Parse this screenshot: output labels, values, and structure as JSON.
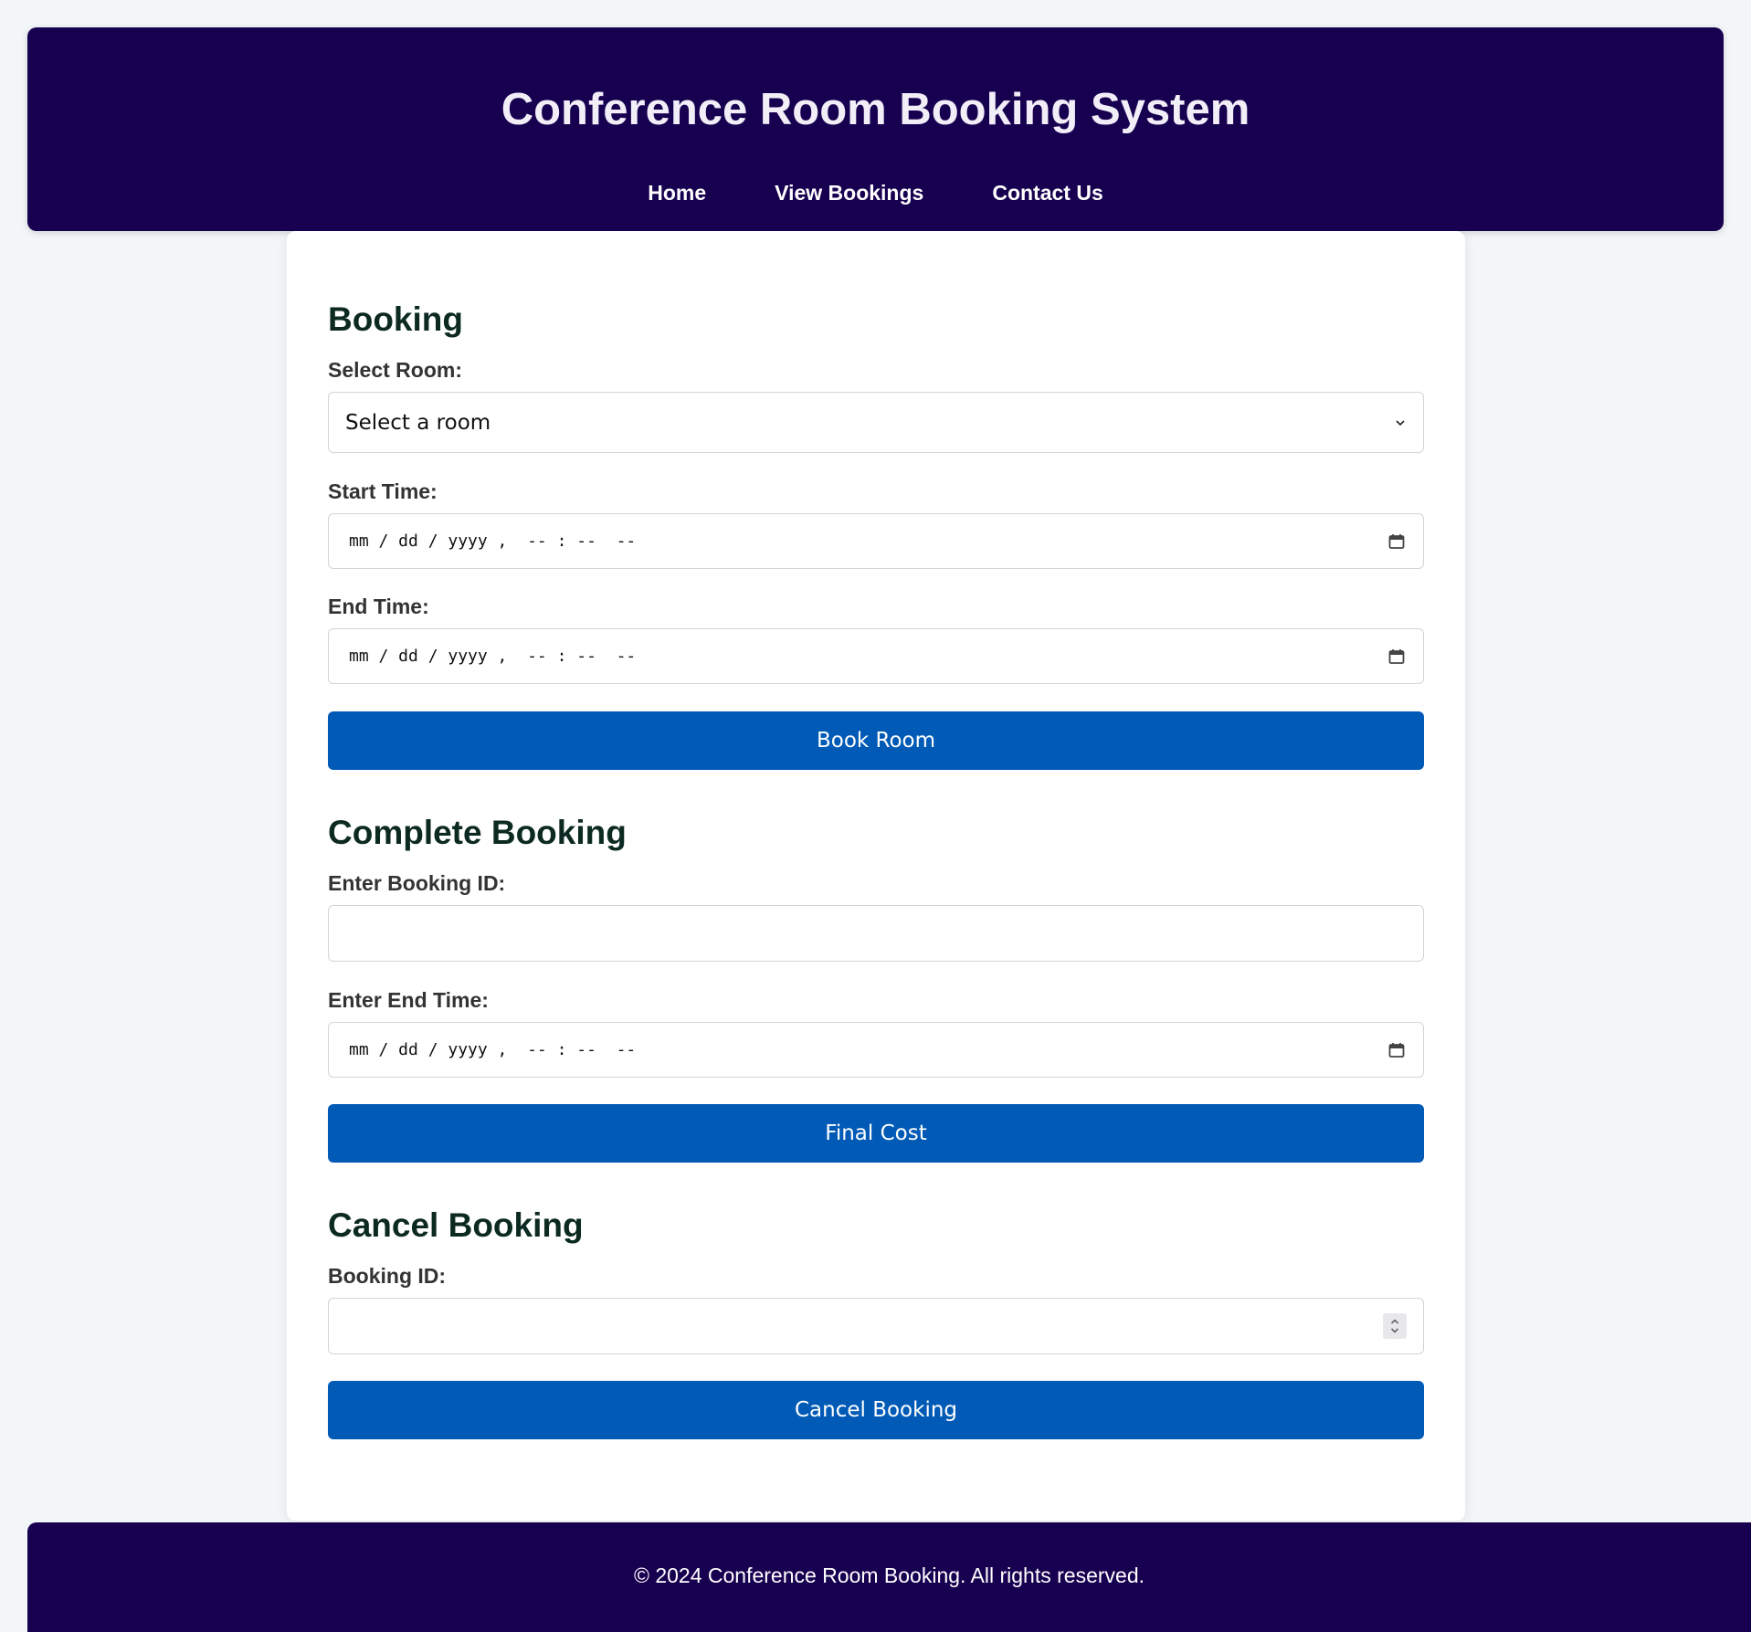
{
  "header": {
    "title": "Conference Room Booking System",
    "nav": [
      {
        "label": "Home"
      },
      {
        "label": "View Bookings"
      },
      {
        "label": "Contact Us"
      }
    ]
  },
  "booking": {
    "title": "Booking",
    "room_label": "Select Room:",
    "room_value": "Select a room",
    "start_label": "Start Time:",
    "start_value": "mm / dd / yyyy ,  -- : --  --",
    "end_label": "End Time:",
    "end_value": "mm / dd / yyyy ,  -- : --  --",
    "button": "Book Room"
  },
  "complete": {
    "title": "Complete Booking",
    "id_label": "Enter Booking ID:",
    "id_value": "",
    "end_label": "Enter End Time:",
    "end_value": "mm / dd / yyyy ,  -- : --  --",
    "button": "Final Cost"
  },
  "cancel": {
    "title": "Cancel Booking",
    "id_label": "Booking ID:",
    "id_value": "",
    "button": "Cancel Booking"
  },
  "footer": {
    "text": "© 2024 Conference Room Booking. All rights reserved."
  },
  "colors": {
    "header_bg": "#180050",
    "button_bg": "#005ab6",
    "page_bg": "#f2f6f9",
    "section_title": "#0c2a22"
  },
  "icons": {
    "select_chevron": "chevron-down-icon",
    "datetime_picker": "calendar-icon",
    "number_spinner": "spinner-icon"
  }
}
